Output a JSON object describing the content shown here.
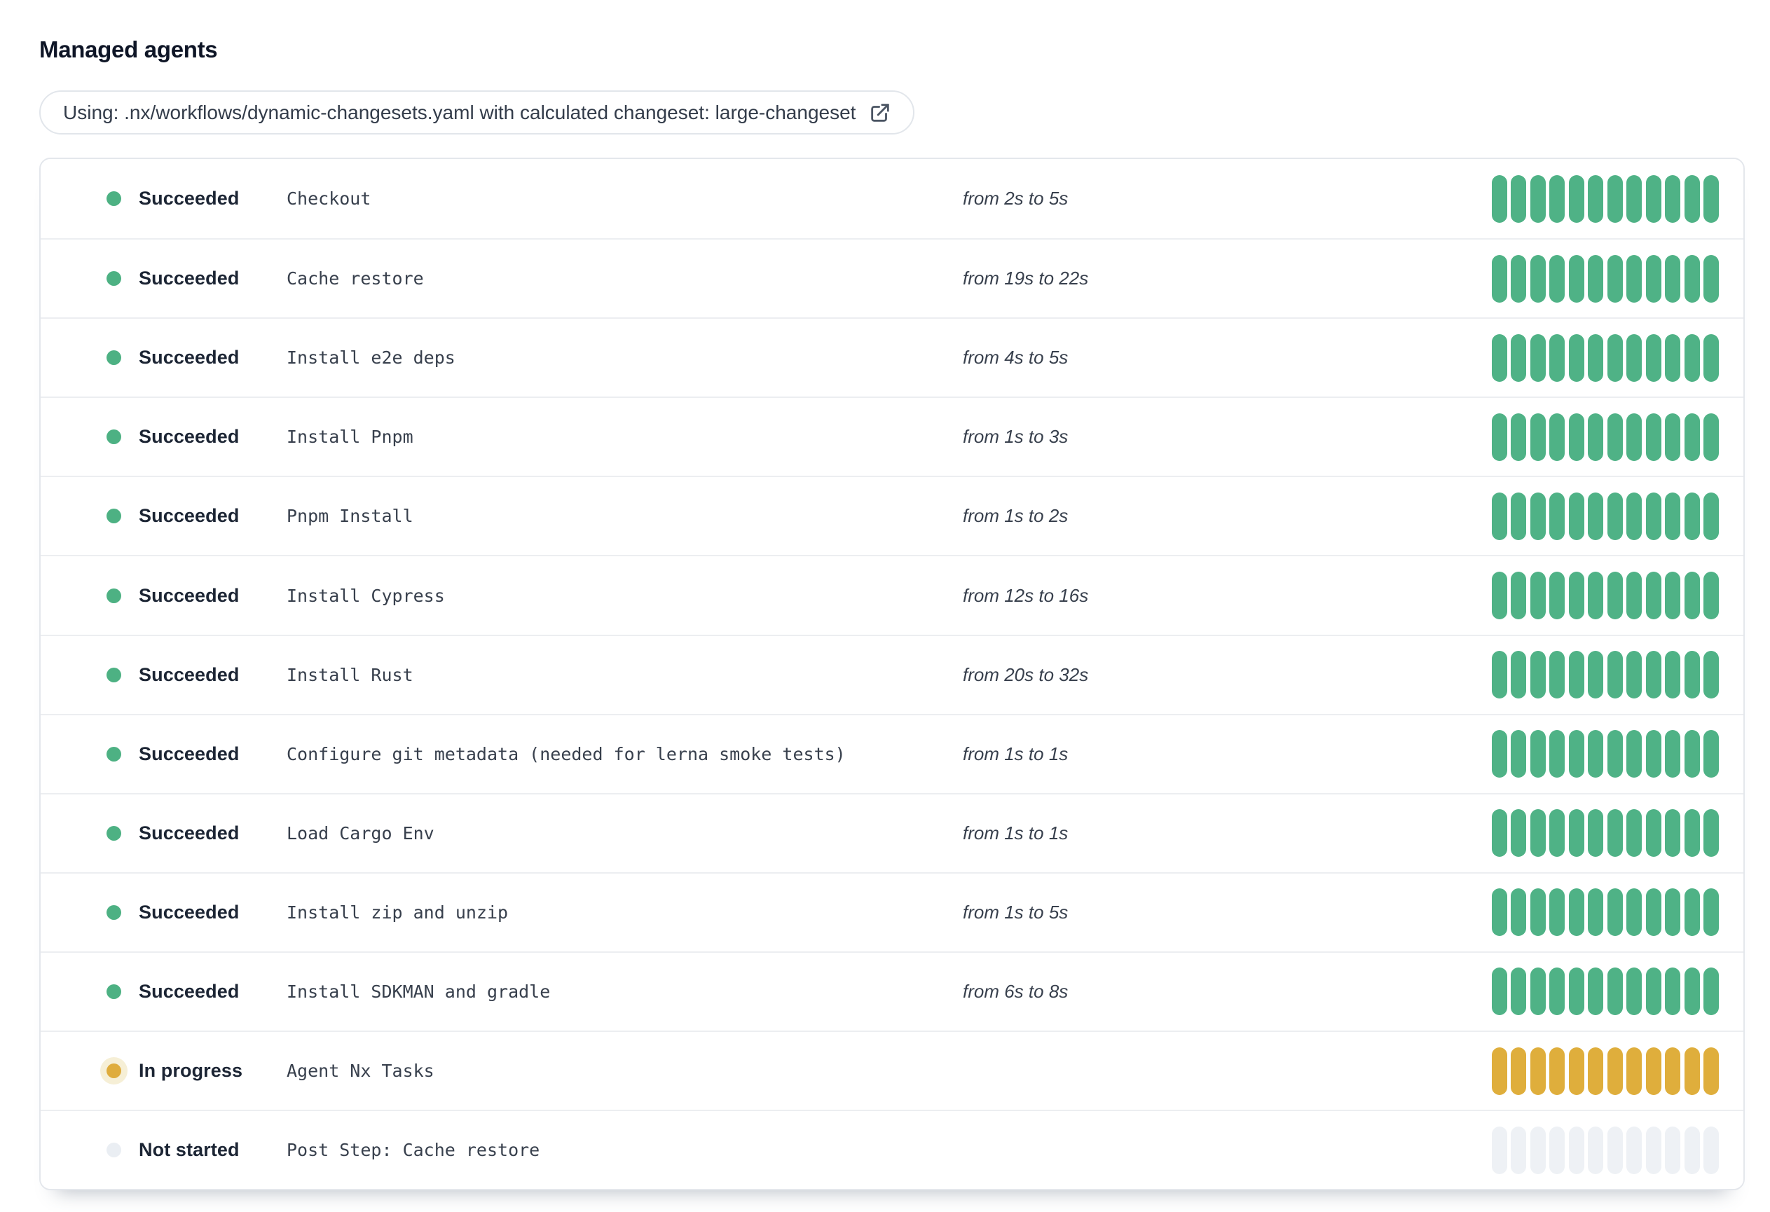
{
  "page": {
    "title": "Managed agents"
  },
  "banner": {
    "label": "Using: .nx/workflows/dynamic-changesets.yaml with calculated changeset: large-changeset",
    "icon": "external-link-icon"
  },
  "colors": {
    "succeeded": "#4fb286",
    "in_progress": "#dfae3c",
    "in_progress_halo": "#f6efd6",
    "not_started_dot": "#eaeef3",
    "not_started_bar": "#eef1f5",
    "status_text": "#1c2534",
    "card_border": "#e4e7ec"
  },
  "agents": {
    "bar_count": 12,
    "rows": [
      {
        "status": "succeeded",
        "status_label": "Succeeded",
        "name": "Checkout",
        "duration": "from 2s to 5s"
      },
      {
        "status": "succeeded",
        "status_label": "Succeeded",
        "name": "Cache restore",
        "duration": "from 19s to 22s"
      },
      {
        "status": "succeeded",
        "status_label": "Succeeded",
        "name": "Install e2e deps",
        "duration": "from 4s to 5s"
      },
      {
        "status": "succeeded",
        "status_label": "Succeeded",
        "name": "Install Pnpm",
        "duration": "from 1s to 3s"
      },
      {
        "status": "succeeded",
        "status_label": "Succeeded",
        "name": "Pnpm Install",
        "duration": "from 1s to 2s"
      },
      {
        "status": "succeeded",
        "status_label": "Succeeded",
        "name": "Install Cypress",
        "duration": "from 12s to 16s"
      },
      {
        "status": "succeeded",
        "status_label": "Succeeded",
        "name": "Install Rust",
        "duration": "from 20s to 32s"
      },
      {
        "status": "succeeded",
        "status_label": "Succeeded",
        "name": "Configure git metadata (needed for lerna smoke tests)",
        "duration": "from 1s to 1s"
      },
      {
        "status": "succeeded",
        "status_label": "Succeeded",
        "name": "Load Cargo Env",
        "duration": "from 1s to 1s"
      },
      {
        "status": "succeeded",
        "status_label": "Succeeded",
        "name": "Install zip and unzip",
        "duration": "from 1s to 5s"
      },
      {
        "status": "succeeded",
        "status_label": "Succeeded",
        "name": "Install SDKMAN and gradle",
        "duration": "from 6s to 8s"
      },
      {
        "status": "in_progress",
        "status_label": "In progress",
        "name": "Agent Nx Tasks",
        "duration": ""
      },
      {
        "status": "not_started",
        "status_label": "Not started",
        "name": "Post Step: Cache restore",
        "duration": ""
      }
    ]
  }
}
